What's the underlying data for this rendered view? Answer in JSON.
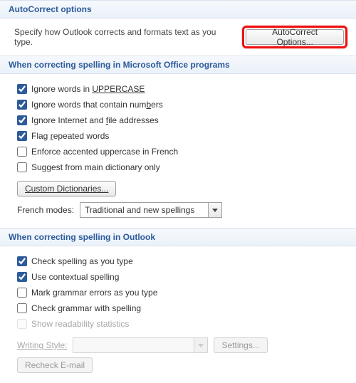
{
  "autocorrect": {
    "header": "AutoCorrect options",
    "intro": "Specify how Outlook corrects and formats text as you type.",
    "button": "AutoCorrect Options..."
  },
  "office": {
    "header": "When correcting spelling in Microsoft Office programs",
    "items": [
      {
        "label_pre": "Ignore words in ",
        "label_u": "UPPERCASE",
        "label_post": "",
        "checked": true
      },
      {
        "label_pre": "Ignore words that contain num",
        "label_u": "b",
        "label_post": "ers",
        "checked": true
      },
      {
        "label_pre": "Ignore Internet and ",
        "label_u": "f",
        "label_post": "ile addresses",
        "checked": true
      },
      {
        "label_pre": "Flag ",
        "label_u": "r",
        "label_post": "epeated words",
        "checked": true
      },
      {
        "label_pre": "Enforce accented uppercase in French",
        "label_u": "",
        "label_post": "",
        "checked": false
      },
      {
        "label_pre": "Suggest from main dictionary only",
        "label_u": "",
        "label_post": "",
        "checked": false
      }
    ],
    "custom_dict_btn": "Custom Dictionaries...",
    "french_label": "French modes:",
    "french_value": "Traditional and new spellings"
  },
  "outlook": {
    "header": "When correcting spelling in Outlook",
    "items": [
      {
        "label": "Check spelling as you type",
        "checked": true,
        "disabled": false
      },
      {
        "label": "Use contextual spelling",
        "checked": true,
        "disabled": false
      },
      {
        "label": "Mark grammar errors as you type",
        "checked": false,
        "disabled": false
      },
      {
        "label": "Check grammar with spelling",
        "checked": false,
        "disabled": false
      },
      {
        "label": "Show readability statistics",
        "checked": false,
        "disabled": true
      }
    ],
    "writing_style_label": "Writing Style:",
    "writing_style_value": "",
    "settings_btn": "Settings...",
    "recheck_btn": "Recheck E-mail"
  }
}
